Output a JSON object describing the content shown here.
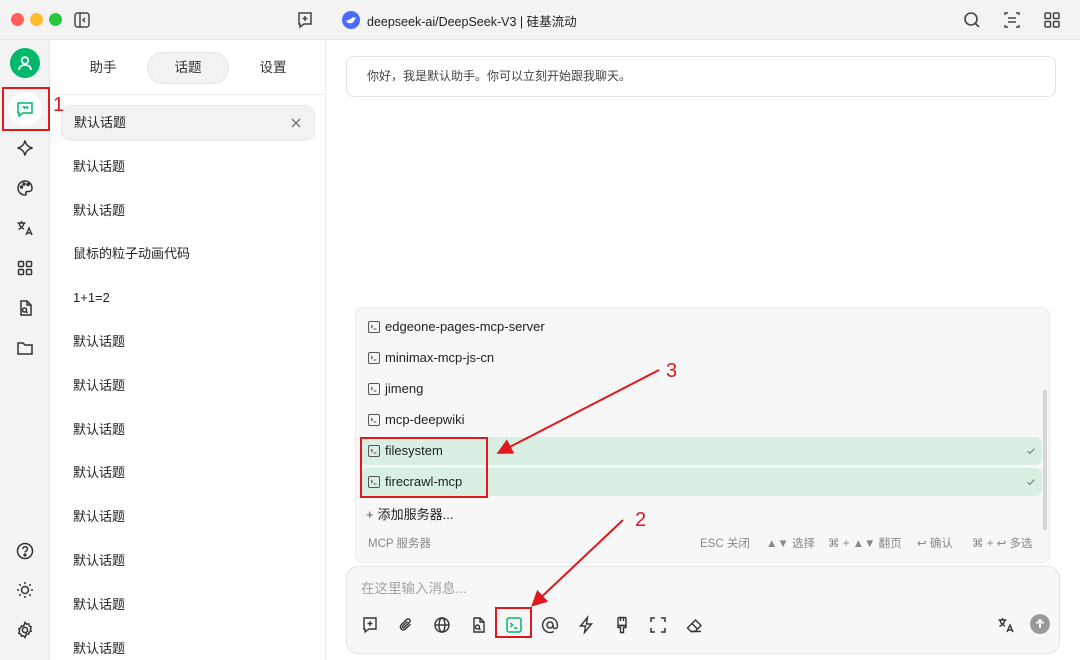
{
  "window": {
    "model_title": "deepseek-ai/DeepSeek-V3 | 硅基流动"
  },
  "colors": {
    "accent": "#00b96b",
    "selected": "#d8efe2",
    "annotation": "#e0191f"
  },
  "rail": {
    "icons": [
      "user-avatar-icon",
      "chat-icon",
      "sparkle-icon",
      "palette-icon",
      "translate-icon",
      "apps-grid-icon",
      "document-search-icon",
      "folder-icon",
      "help-icon",
      "sun-icon",
      "settings-icon"
    ]
  },
  "sidebar": {
    "tabs": [
      "助手",
      "话题",
      "设置"
    ],
    "active_tab": 1,
    "topics": [
      "默认话题",
      "默认话题",
      "默认话题",
      "鼠标的粒子动画代码",
      "1+1=2",
      "默认话题",
      "默认话题",
      "默认话题",
      "默认话题",
      "默认话题",
      "默认话题",
      "默认话题",
      "默认话题"
    ]
  },
  "chat": {
    "greeting": "你好，我是默认助手。你可以立刻开始跟我聊天。"
  },
  "mcp": {
    "items": [
      {
        "label": "edgeone-pages-mcp-server",
        "selected": false
      },
      {
        "label": "minimax-mcp-js-cn",
        "selected": false
      },
      {
        "label": "jimeng",
        "selected": false
      },
      {
        "label": "mcp-deepwiki",
        "selected": false
      },
      {
        "label": "filesystem",
        "selected": true
      },
      {
        "label": "firecrawl-mcp",
        "selected": true
      }
    ],
    "add_label": "添加服务器...",
    "footer_title": "MCP 服务器",
    "hints": [
      "ESC 关闭",
      "▲▼ 选择",
      "⌘ + ▲▼ 翻页",
      "↩ 确认",
      "⌘ + ↩ 多选"
    ]
  },
  "input": {
    "placeholder": "在这里输入消息..."
  },
  "annotations": [
    "1",
    "2",
    "3"
  ]
}
